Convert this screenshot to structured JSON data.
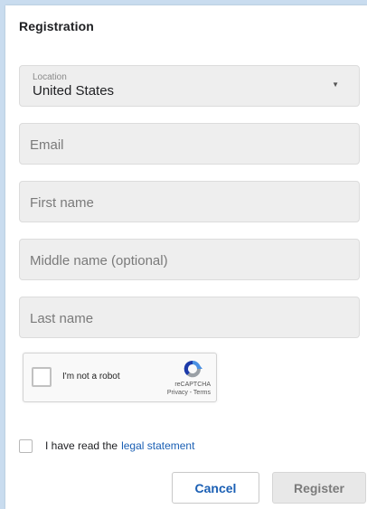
{
  "dialog": {
    "title": "Registration"
  },
  "form": {
    "location": {
      "label": "Location",
      "value": "United States",
      "arrow": "▼"
    },
    "email": {
      "placeholder": "Email"
    },
    "first_name": {
      "placeholder": "First name"
    },
    "middle_name": {
      "placeholder": "Middle name (optional)"
    },
    "last_name": {
      "placeholder": "Last name"
    }
  },
  "captcha": {
    "label": "I'm not a robot",
    "brand": "reCAPTCHA",
    "links": "Privacy - Terms",
    "icon": "recaptcha-logo"
  },
  "legal": {
    "prefix": "I have read the",
    "link_text": "legal statement"
  },
  "buttons": {
    "cancel": "Cancel",
    "register": "Register"
  },
  "colors": {
    "accent": "#1a5fb4",
    "field_bg": "#eeeeee",
    "page_bg": "#c9dcef"
  }
}
